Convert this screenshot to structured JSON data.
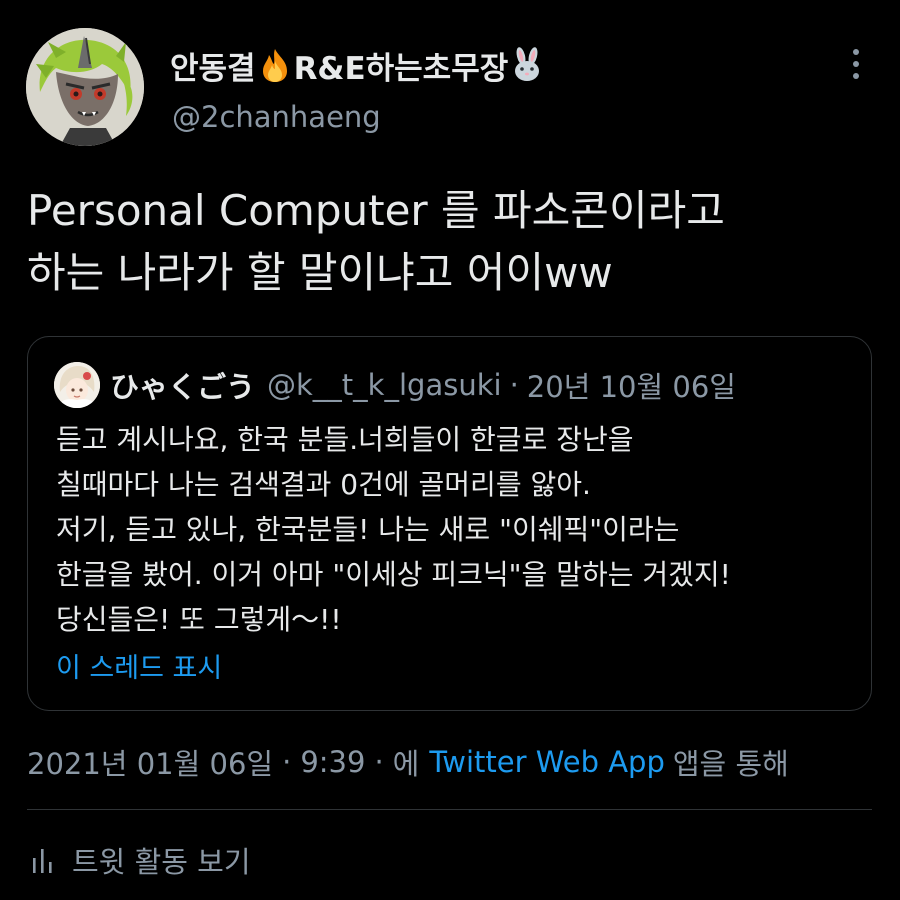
{
  "author": {
    "display_name_part1": "안동결",
    "display_name_part2": "R&E하는초무장",
    "name_emoji_1": "fire-emoji",
    "name_emoji_2": "rabbit-emoji",
    "handle": "@2chanhaeng"
  },
  "tweet": {
    "text_lines": [
      "Personal Computer 를 파소콘이라고",
      "하는 나라가 할 말이냐고 어이ww"
    ]
  },
  "quote": {
    "name": "ひゃくごう",
    "handle": "@k__t_k_lgasuki",
    "separator": "·",
    "date": "20년 10월 06일",
    "body_lines": [
      "듣고 계시나요, 한국 분들.너희들이 한글로 장난을",
      "칠때마다 나는 검색결과 0건에 골머리를 앓아.",
      "저기, 듣고 있나, 한국분들! 나는 새로 \"이쉐픽\"이라는",
      "한글을 봤어. 이거 아마 \"이세상 피크닉\"을 말하는 거겠지!",
      "당신들은! 또 그렇게～!!"
    ],
    "show_thread": "이 스레드 표시"
  },
  "meta": {
    "date": "2021년 01월 06일",
    "separator": "·",
    "time": "9:39",
    "prefix": "에",
    "app": "Twitter Web App",
    "suffix": "앱을 통해"
  },
  "activity": {
    "label": "트윗 활동 보기",
    "icon": "bar-chart-icon"
  },
  "colors": {
    "background": "#000000",
    "primary_text": "#e7e9ea",
    "secondary_text": "#8b98a5",
    "link": "#1d9bf0",
    "border": "#2f3336"
  },
  "icons": {
    "more": "more-vertical-icon"
  }
}
